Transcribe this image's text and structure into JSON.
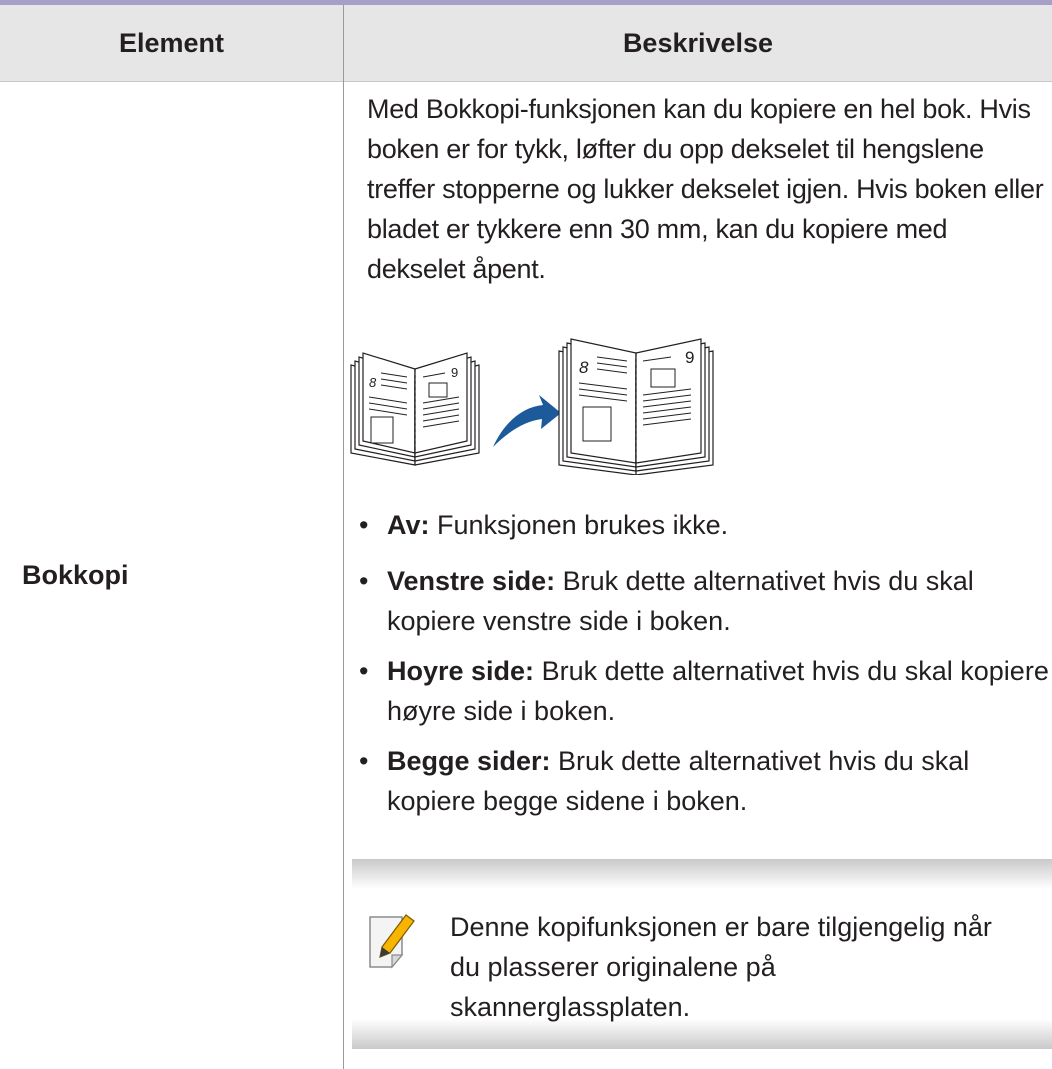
{
  "table": {
    "header": {
      "element": "Element",
      "description": "Beskrivelse"
    },
    "row": {
      "element": "Bokkopi",
      "intro": "Med Bokkopi-funksjonen kan du kopiere en hel bok. Hvis boken er for tykk, løfter du opp dekselet til hengslene treffer stopperne og lukker dekselet igjen. Hvis boken eller bladet er tykkere enn 30 mm, kan du kopiere med dekselet åpent.",
      "illustration": {
        "left_page_number": "8",
        "right_page_number": "9",
        "arrow_color": "#1d5a9c"
      },
      "options": [
        {
          "name": "Av:",
          "text": " Funksjonen brukes ikke."
        },
        {
          "name": "Venstre side:",
          "text": " Bruk dette alternativet hvis du skal kopiere venstre side i boken."
        },
        {
          "name": "Hoyre side:",
          "text": " Bruk dette alternativet hvis du skal kopiere høyre side i boken."
        },
        {
          "name": "Begge sider:",
          "text": " Bruk dette alternativet hvis du skal kopiere begge sidene i boken."
        }
      ],
      "bullet": "•",
      "note": {
        "icon": "note-pencil-icon",
        "text": "Denne kopifunksjonen er bare tilgjengelig når du plasserer originalene på skannerglassplaten."
      }
    }
  },
  "colors": {
    "header_bg": "#e6e6e6",
    "top_rule": "#a79fc9",
    "pencil": "#f7b500"
  }
}
